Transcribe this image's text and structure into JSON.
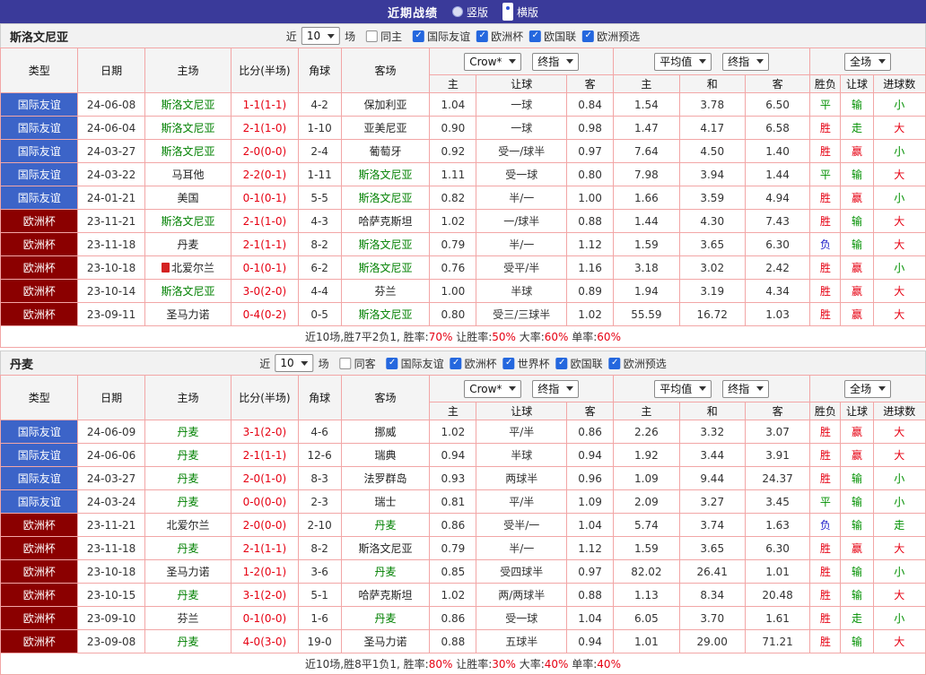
{
  "top_bar": {
    "title": "近期战绩",
    "options": [
      {
        "label": "竖版",
        "selected": false
      },
      {
        "label": "横版",
        "selected": true
      }
    ]
  },
  "icons": {
    "check": "✓"
  },
  "colors": {
    "topbar_bg": "#3A3A9A",
    "grid_border": "#F2A6A6",
    "type_friendly_bg": "#3C64C8",
    "type_eurocup_bg": "#8B0000",
    "win_red": "#E60012",
    "draw_green": "#009000",
    "lose_blue": "#1C1CC8",
    "team_link_green": "#008000",
    "checkbox_blue": "#2467DE"
  },
  "table_header": {
    "cols": [
      "类型",
      "日期",
      "主场",
      "比分(半场)",
      "角球",
      "客场"
    ],
    "odds_group1": {
      "select1": "Crow*",
      "select2": "终指",
      "cols": [
        "主",
        "让球",
        "客"
      ]
    },
    "odds_group2": {
      "select1": "平均值",
      "select2": "终指",
      "cols": [
        "主",
        "和",
        "客"
      ]
    },
    "odds_group3": {
      "select1": "全场",
      "cols": [
        "胜负",
        "让球",
        "进球数"
      ]
    }
  },
  "sections": [
    {
      "team": "斯洛文尼亚",
      "filter": {
        "near": "近",
        "count": "10",
        "games": "场",
        "same": {
          "label": "同主",
          "checked": false
        },
        "leagues": [
          {
            "label": "国际友谊",
            "checked": true
          },
          {
            "label": "欧洲杯",
            "checked": true
          },
          {
            "label": "欧国联",
            "checked": true
          },
          {
            "label": "欧洲预选",
            "checked": true
          }
        ]
      },
      "rows": [
        {
          "type": "国际友谊",
          "tc": "blue",
          "date": "24-06-08",
          "home": "斯洛文尼亚",
          "hg": true,
          "hi": false,
          "score": "1-1(1-1)",
          "corner": "4-2",
          "away": "保加利亚",
          "ag": false,
          "o1": "1.04",
          "let": "一球",
          "o2": "0.84",
          "m1": "1.54",
          "m2": "3.78",
          "m3": "6.50",
          "r1": [
            "平",
            "green"
          ],
          "r2": [
            "输",
            "green"
          ],
          "r3": [
            "小",
            "green"
          ]
        },
        {
          "type": "国际友谊",
          "tc": "blue",
          "date": "24-06-04",
          "home": "斯洛文尼亚",
          "hg": true,
          "hi": false,
          "score": "2-1(1-0)",
          "corner": "1-10",
          "away": "亚美尼亚",
          "ag": false,
          "o1": "0.90",
          "let": "一球",
          "o2": "0.98",
          "m1": "1.47",
          "m2": "4.17",
          "m3": "6.58",
          "r1": [
            "胜",
            "red"
          ],
          "r2": [
            "走",
            "green"
          ],
          "r3": [
            "大",
            "red"
          ]
        },
        {
          "type": "国际友谊",
          "tc": "blue",
          "date": "24-03-27",
          "home": "斯洛文尼亚",
          "hg": true,
          "hi": false,
          "score": "2-0(0-0)",
          "corner": "2-4",
          "away": "葡萄牙",
          "ag": false,
          "o1": "0.92",
          "let": "受一/球半",
          "o2": "0.97",
          "m1": "7.64",
          "m2": "4.50",
          "m3": "1.40",
          "r1": [
            "胜",
            "red"
          ],
          "r2": [
            "赢",
            "red"
          ],
          "r3": [
            "小",
            "green"
          ]
        },
        {
          "type": "国际友谊",
          "tc": "blue",
          "date": "24-03-22",
          "home": "马耳他",
          "hg": false,
          "hi": false,
          "score": "2-2(0-1)",
          "corner": "1-11",
          "away": "斯洛文尼亚",
          "ag": true,
          "o1": "1.11",
          "let": "受一球",
          "o2": "0.80",
          "m1": "7.98",
          "m2": "3.94",
          "m3": "1.44",
          "r1": [
            "平",
            "green"
          ],
          "r2": [
            "输",
            "green"
          ],
          "r3": [
            "大",
            "red"
          ]
        },
        {
          "type": "国际友谊",
          "tc": "blue",
          "date": "24-01-21",
          "home": "美国",
          "hg": false,
          "hi": false,
          "score": "0-1(0-1)",
          "corner": "5-5",
          "away": "斯洛文尼亚",
          "ag": true,
          "o1": "0.82",
          "let": "半/一",
          "o2": "1.00",
          "m1": "1.66",
          "m2": "3.59",
          "m3": "4.94",
          "r1": [
            "胜",
            "red"
          ],
          "r2": [
            "赢",
            "red"
          ],
          "r3": [
            "小",
            "green"
          ]
        },
        {
          "type": "欧洲杯",
          "tc": "red",
          "date": "23-11-21",
          "home": "斯洛文尼亚",
          "hg": true,
          "hi": false,
          "score": "2-1(1-0)",
          "corner": "4-3",
          "away": "哈萨克斯坦",
          "ag": false,
          "o1": "1.02",
          "let": "一/球半",
          "o2": "0.88",
          "m1": "1.44",
          "m2": "4.30",
          "m3": "7.43",
          "r1": [
            "胜",
            "red"
          ],
          "r2": [
            "输",
            "green"
          ],
          "r3": [
            "大",
            "red"
          ]
        },
        {
          "type": "欧洲杯",
          "tc": "red",
          "date": "23-11-18",
          "home": "丹麦",
          "hg": false,
          "hi": false,
          "score": "2-1(1-1)",
          "corner": "8-2",
          "away": "斯洛文尼亚",
          "ag": true,
          "o1": "0.79",
          "let": "半/一",
          "o2": "1.12",
          "m1": "1.59",
          "m2": "3.65",
          "m3": "6.30",
          "r1": [
            "负",
            "blue"
          ],
          "r2": [
            "输",
            "green"
          ],
          "r3": [
            "大",
            "red"
          ]
        },
        {
          "type": "欧洲杯",
          "tc": "red",
          "date": "23-10-18",
          "home": "北爱尔兰",
          "hg": false,
          "hi": true,
          "score": "0-1(0-1)",
          "corner": "6-2",
          "away": "斯洛文尼亚",
          "ag": true,
          "o1": "0.76",
          "let": "受平/半",
          "o2": "1.16",
          "m1": "3.18",
          "m2": "3.02",
          "m3": "2.42",
          "r1": [
            "胜",
            "red"
          ],
          "r2": [
            "赢",
            "red"
          ],
          "r3": [
            "小",
            "green"
          ]
        },
        {
          "type": "欧洲杯",
          "tc": "red",
          "date": "23-10-14",
          "home": "斯洛文尼亚",
          "hg": true,
          "hi": false,
          "score": "3-0(2-0)",
          "corner": "4-4",
          "away": "芬兰",
          "ag": false,
          "o1": "1.00",
          "let": "半球",
          "o2": "0.89",
          "m1": "1.94",
          "m2": "3.19",
          "m3": "4.34",
          "r1": [
            "胜",
            "red"
          ],
          "r2": [
            "赢",
            "red"
          ],
          "r3": [
            "大",
            "red"
          ]
        },
        {
          "type": "欧洲杯",
          "tc": "red",
          "date": "23-09-11",
          "home": "圣马力诺",
          "hg": false,
          "hi": false,
          "score": "0-4(0-2)",
          "corner": "0-5",
          "away": "斯洛文尼亚",
          "ag": true,
          "o1": "0.80",
          "let": "受三/三球半",
          "o2": "1.02",
          "m1": "55.59",
          "m2": "16.72",
          "m3": "1.03",
          "r1": [
            "胜",
            "red"
          ],
          "r2": [
            "赢",
            "red"
          ],
          "r3": [
            "大",
            "red"
          ]
        }
      ],
      "summary": [
        {
          "text": "近10场,胜7平2负1, 胜率:",
          "red": false
        },
        {
          "text": "70%",
          "red": true
        },
        {
          "text": " 让胜率:",
          "red": false
        },
        {
          "text": "50%",
          "red": true
        },
        {
          "text": " 大率:",
          "red": false
        },
        {
          "text": "60%",
          "red": true
        },
        {
          "text": " 单率:",
          "red": false
        },
        {
          "text": "60%",
          "red": true
        }
      ]
    },
    {
      "team": "丹麦",
      "filter": {
        "near": "近",
        "count": "10",
        "games": "场",
        "same": {
          "label": "同客",
          "checked": false
        },
        "leagues": [
          {
            "label": "国际友谊",
            "checked": true
          },
          {
            "label": "欧洲杯",
            "checked": true
          },
          {
            "label": "世界杯",
            "checked": true
          },
          {
            "label": "欧国联",
            "checked": true
          },
          {
            "label": "欧洲预选",
            "checked": true
          }
        ]
      },
      "rows": [
        {
          "type": "国际友谊",
          "tc": "blue",
          "date": "24-06-09",
          "home": "丹麦",
          "hg": true,
          "hi": false,
          "score": "3-1(2-0)",
          "corner": "4-6",
          "away": "挪威",
          "ag": false,
          "o1": "1.02",
          "let": "平/半",
          "o2": "0.86",
          "m1": "2.26",
          "m2": "3.32",
          "m3": "3.07",
          "r1": [
            "胜",
            "red"
          ],
          "r2": [
            "赢",
            "red"
          ],
          "r3": [
            "大",
            "red"
          ]
        },
        {
          "type": "国际友谊",
          "tc": "blue",
          "date": "24-06-06",
          "home": "丹麦",
          "hg": true,
          "hi": false,
          "score": "2-1(1-1)",
          "corner": "12-6",
          "away": "瑞典",
          "ag": false,
          "o1": "0.94",
          "let": "半球",
          "o2": "0.94",
          "m1": "1.92",
          "m2": "3.44",
          "m3": "3.91",
          "r1": [
            "胜",
            "red"
          ],
          "r2": [
            "赢",
            "red"
          ],
          "r3": [
            "大",
            "red"
          ]
        },
        {
          "type": "国际友谊",
          "tc": "blue",
          "date": "24-03-27",
          "home": "丹麦",
          "hg": true,
          "hi": false,
          "score": "2-0(1-0)",
          "corner": "8-3",
          "away": "法罗群岛",
          "ag": false,
          "o1": "0.93",
          "let": "两球半",
          "o2": "0.96",
          "m1": "1.09",
          "m2": "9.44",
          "m3": "24.37",
          "r1": [
            "胜",
            "red"
          ],
          "r2": [
            "输",
            "green"
          ],
          "r3": [
            "小",
            "green"
          ]
        },
        {
          "type": "国际友谊",
          "tc": "blue",
          "date": "24-03-24",
          "home": "丹麦",
          "hg": true,
          "hi": false,
          "score": "0-0(0-0)",
          "corner": "2-3",
          "away": "瑞士",
          "ag": false,
          "o1": "0.81",
          "let": "平/半",
          "o2": "1.09",
          "m1": "2.09",
          "m2": "3.27",
          "m3": "3.45",
          "r1": [
            "平",
            "green"
          ],
          "r2": [
            "输",
            "green"
          ],
          "r3": [
            "小",
            "green"
          ]
        },
        {
          "type": "欧洲杯",
          "tc": "red",
          "date": "23-11-21",
          "home": "北爱尔兰",
          "hg": false,
          "hi": false,
          "score": "2-0(0-0)",
          "corner": "2-10",
          "away": "丹麦",
          "ag": true,
          "o1": "0.86",
          "let": "受半/一",
          "o2": "1.04",
          "m1": "5.74",
          "m2": "3.74",
          "m3": "1.63",
          "r1": [
            "负",
            "blue"
          ],
          "r2": [
            "输",
            "green"
          ],
          "r3": [
            "走",
            "green"
          ]
        },
        {
          "type": "欧洲杯",
          "tc": "red",
          "date": "23-11-18",
          "home": "丹麦",
          "hg": true,
          "hi": false,
          "score": "2-1(1-1)",
          "corner": "8-2",
          "away": "斯洛文尼亚",
          "ag": false,
          "o1": "0.79",
          "let": "半/一",
          "o2": "1.12",
          "m1": "1.59",
          "m2": "3.65",
          "m3": "6.30",
          "r1": [
            "胜",
            "red"
          ],
          "r2": [
            "赢",
            "red"
          ],
          "r3": [
            "大",
            "red"
          ]
        },
        {
          "type": "欧洲杯",
          "tc": "red",
          "date": "23-10-18",
          "home": "圣马力诺",
          "hg": false,
          "hi": false,
          "score": "1-2(0-1)",
          "corner": "3-6",
          "away": "丹麦",
          "ag": true,
          "o1": "0.85",
          "let": "受四球半",
          "o2": "0.97",
          "m1": "82.02",
          "m2": "26.41",
          "m3": "1.01",
          "r1": [
            "胜",
            "red"
          ],
          "r2": [
            "输",
            "green"
          ],
          "r3": [
            "小",
            "green"
          ]
        },
        {
          "type": "欧洲杯",
          "tc": "red",
          "date": "23-10-15",
          "home": "丹麦",
          "hg": true,
          "hi": false,
          "score": "3-1(2-0)",
          "corner": "5-1",
          "away": "哈萨克斯坦",
          "ag": false,
          "o1": "1.02",
          "let": "两/两球半",
          "o2": "0.88",
          "m1": "1.13",
          "m2": "8.34",
          "m3": "20.48",
          "r1": [
            "胜",
            "red"
          ],
          "r2": [
            "输",
            "green"
          ],
          "r3": [
            "大",
            "red"
          ]
        },
        {
          "type": "欧洲杯",
          "tc": "red",
          "date": "23-09-10",
          "home": "芬兰",
          "hg": false,
          "hi": false,
          "score": "0-1(0-0)",
          "corner": "1-6",
          "away": "丹麦",
          "ag": true,
          "o1": "0.86",
          "let": "受一球",
          "o2": "1.04",
          "m1": "6.05",
          "m2": "3.70",
          "m3": "1.61",
          "r1": [
            "胜",
            "red"
          ],
          "r2": [
            "走",
            "green"
          ],
          "r3": [
            "小",
            "green"
          ]
        },
        {
          "type": "欧洲杯",
          "tc": "red",
          "date": "23-09-08",
          "home": "丹麦",
          "hg": true,
          "hi": false,
          "score": "4-0(3-0)",
          "corner": "19-0",
          "away": "圣马力诺",
          "ag": false,
          "o1": "0.88",
          "let": "五球半",
          "o2": "0.94",
          "m1": "1.01",
          "m2": "29.00",
          "m3": "71.21",
          "r1": [
            "胜",
            "red"
          ],
          "r2": [
            "输",
            "green"
          ],
          "r3": [
            "大",
            "red"
          ]
        }
      ],
      "summary": [
        {
          "text": "近10场,胜8平1负1, 胜率:",
          "red": false
        },
        {
          "text": "80%",
          "red": true
        },
        {
          "text": " 让胜率:",
          "red": false
        },
        {
          "text": "30%",
          "red": true
        },
        {
          "text": " 大率:",
          "red": false
        },
        {
          "text": "40%",
          "red": true
        },
        {
          "text": " 单率:",
          "red": false
        },
        {
          "text": "40%",
          "red": true
        }
      ]
    }
  ]
}
